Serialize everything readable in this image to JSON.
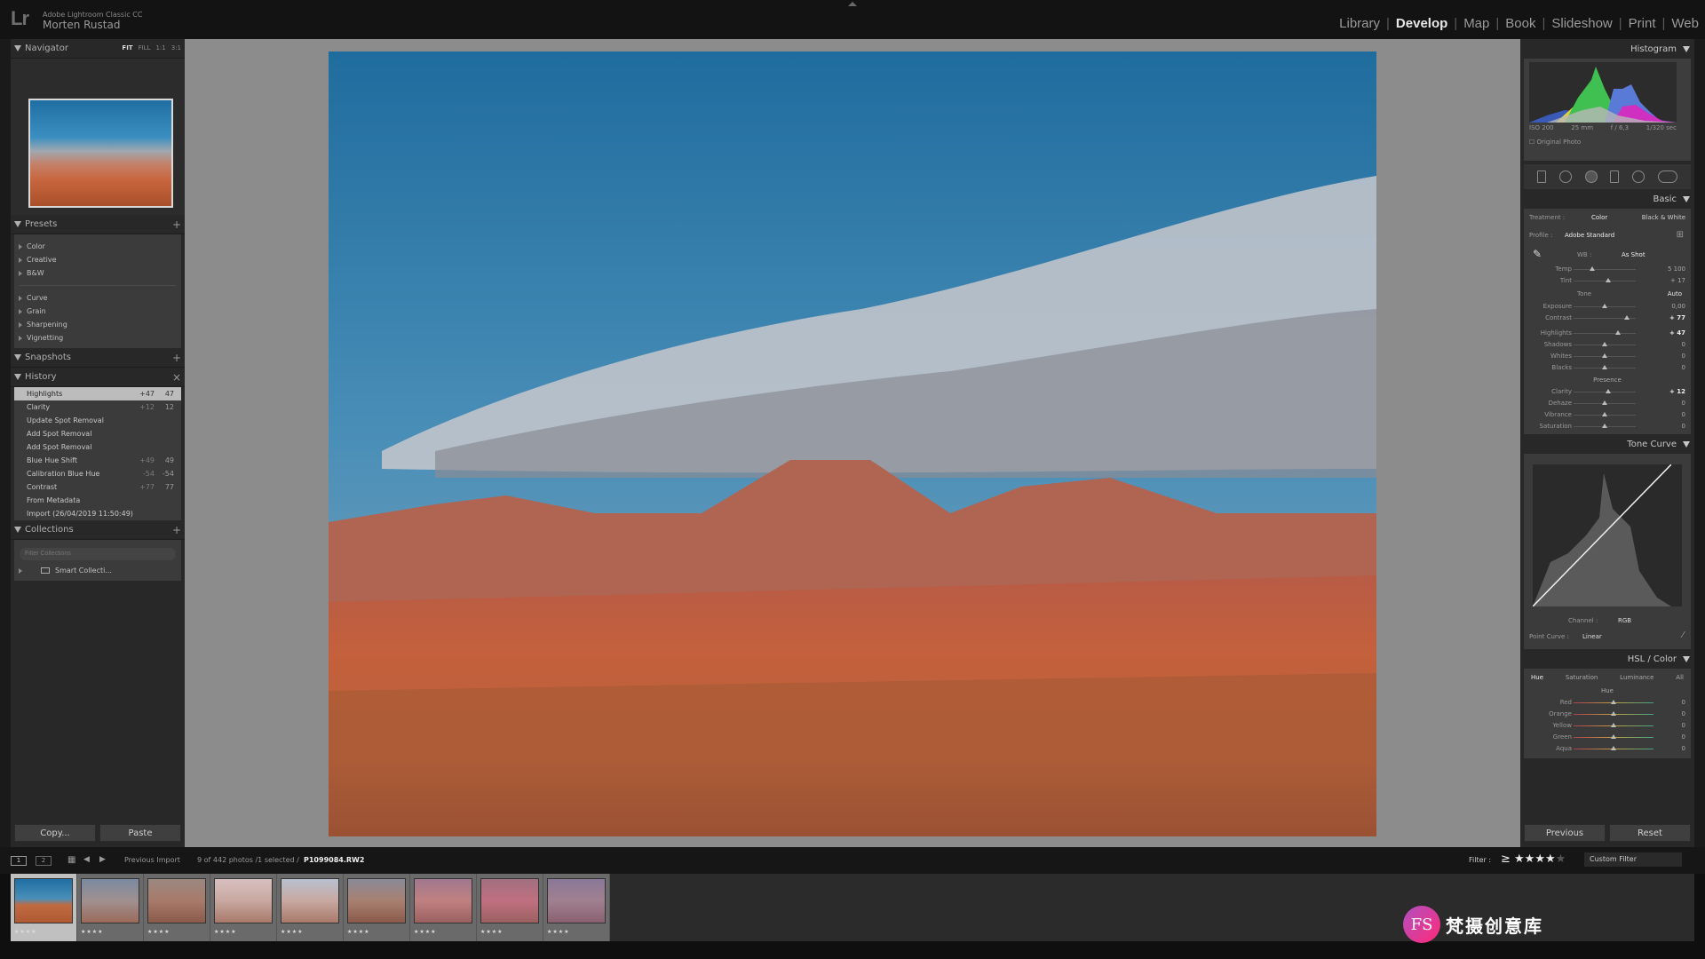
{
  "app": {
    "product": "Adobe Lightroom Classic CC",
    "user": "Morten Rustad",
    "logo": "Lr"
  },
  "modules": [
    {
      "label": "Library",
      "active": false
    },
    {
      "label": "Develop",
      "active": true
    },
    {
      "label": "Map",
      "active": false
    },
    {
      "label": "Book",
      "active": false
    },
    {
      "label": "Slideshow",
      "active": false
    },
    {
      "label": "Print",
      "active": false
    },
    {
      "label": "Web",
      "active": false
    }
  ],
  "navigator": {
    "title": "Navigator",
    "zoom_options": [
      "FIT",
      "FILL",
      "1:1",
      "3:1"
    ]
  },
  "presets": {
    "title": "Presets",
    "groups1": [
      "Color",
      "Creative",
      "B&W"
    ],
    "groups2": [
      "Curve",
      "Grain",
      "Sharpening",
      "Vignetting"
    ]
  },
  "snapshots": {
    "title": "Snapshots"
  },
  "history": {
    "title": "History",
    "items": [
      {
        "label": "Highlights",
        "before": "+47",
        "after": "47",
        "selected": true
      },
      {
        "label": "Clarity",
        "before": "+12",
        "after": "12"
      },
      {
        "label": "Update Spot Removal",
        "before": "",
        "after": ""
      },
      {
        "label": "Add Spot Removal",
        "before": "",
        "after": ""
      },
      {
        "label": "Add Spot Removal",
        "before": "",
        "after": ""
      },
      {
        "label": "Blue Hue Shift",
        "before": "+49",
        "after": "49"
      },
      {
        "label": "Calibration Blue Hue",
        "before": "-54",
        "after": "-54"
      },
      {
        "label": "Contrast",
        "before": "+77",
        "after": "77"
      },
      {
        "label": "From Metadata",
        "before": "",
        "after": ""
      },
      {
        "label": "Import (26/04/2019 11:50:49)",
        "before": "",
        "after": ""
      }
    ]
  },
  "collections": {
    "title": "Collections",
    "search_placeholder": "Filter Collections",
    "items": [
      "Smart Collecti..."
    ]
  },
  "left_buttons": {
    "copy": "Copy...",
    "paste": "Paste"
  },
  "histogram": {
    "title": "Histogram",
    "iso": "ISO 200",
    "focal": "25 mm",
    "aperture": "f / 6,3",
    "shutter": "1/320 sec",
    "original_photo": "Original Photo"
  },
  "basic": {
    "title": "Basic",
    "treatment_label": "Treatment :",
    "treatment_color": "Color",
    "treatment_bw": "Black & White",
    "profile_label": "Profile :",
    "profile_value": "Adobe Standard",
    "wb_label": "WB :",
    "wb_value": "As Shot",
    "wb_sliders": [
      {
        "label": "Temp",
        "value": "5 100",
        "pos": 0.3
      },
      {
        "label": "Tint",
        "value": "+ 17",
        "pos": 0.55
      }
    ],
    "tone_label": "Tone",
    "auto": "Auto",
    "tone_sliders": [
      {
        "label": "Exposure",
        "value": "0,00",
        "pos": 0.5
      },
      {
        "label": "Contrast",
        "value": "+ 77",
        "pos": 0.85,
        "bright": true
      }
    ],
    "tone_sliders2": [
      {
        "label": "Highlights",
        "value": "+ 47",
        "pos": 0.72,
        "bright": true
      },
      {
        "label": "Shadows",
        "value": "0",
        "pos": 0.5
      },
      {
        "label": "Whites",
        "value": "0",
        "pos": 0.5
      },
      {
        "label": "Blacks",
        "value": "0",
        "pos": 0.5
      }
    ],
    "presence_label": "Presence",
    "presence_sliders": [
      {
        "label": "Clarity",
        "value": "+ 12",
        "pos": 0.55,
        "bright": true
      },
      {
        "label": "Dehaze",
        "value": "0",
        "pos": 0.5
      },
      {
        "label": "Vibrance",
        "value": "0",
        "pos": 0.5
      },
      {
        "label": "Saturation",
        "value": "0",
        "pos": 0.5
      }
    ]
  },
  "tone_curve": {
    "title": "Tone Curve",
    "channel_label": "Channel :",
    "channel_value": "RGB",
    "point_curve_label": "Point Curve :",
    "point_curve_value": "Linear"
  },
  "hsl": {
    "title": "HSL / Color",
    "tabs": [
      "Hue",
      "Saturation",
      "Luminance",
      "All"
    ],
    "section": "Hue",
    "sliders": [
      {
        "label": "Red",
        "value": "0"
      },
      {
        "label": "Orange",
        "value": "0"
      },
      {
        "label": "Yellow",
        "value": "0"
      },
      {
        "label": "Green",
        "value": "0"
      },
      {
        "label": "Aqua",
        "value": "0"
      }
    ]
  },
  "right_buttons": {
    "previous": "Previous",
    "reset": "Reset"
  },
  "filmstrip_bar": {
    "source": "Previous Import",
    "count": "9 of 442 photos /1 selected /",
    "filename": "P1099084.RW2",
    "filter_label": "Filter :",
    "filter_rating": 4,
    "filter_preset": "Custom Filter"
  },
  "filmstrip": {
    "frames": [
      {
        "stars": "★★★★",
        "selected": true
      },
      {
        "stars": "★★★★"
      },
      {
        "stars": "★★★★"
      },
      {
        "stars": "★★★★"
      },
      {
        "stars": "★★★★"
      },
      {
        "stars": "★★★★"
      },
      {
        "stars": "★★★★"
      },
      {
        "stars": "★★★★"
      },
      {
        "stars": "★★★★"
      }
    ]
  },
  "watermark": {
    "logo": "FS",
    "text": "梵摄创意库"
  }
}
